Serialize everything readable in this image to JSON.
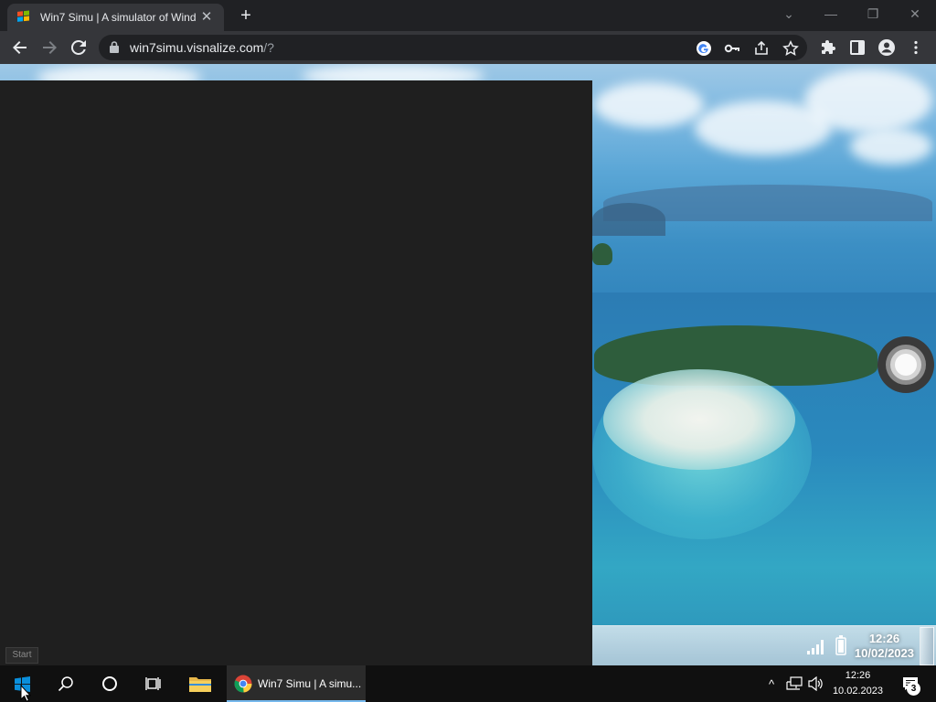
{
  "browser": {
    "tab": {
      "title": "Win7 Simu | A simulator of Wind",
      "close_glyph": "✕"
    },
    "new_tab_glyph": "+",
    "window_controls": {
      "tabsearch": "⌄",
      "minimize": "—",
      "restore": "❐",
      "close": "✕"
    },
    "address": {
      "host": "win7simu.visnalize.com",
      "path": "/?"
    }
  },
  "simulator": {
    "taskbar": {
      "time": "12:26",
      "date": "10/02/2023"
    }
  },
  "taskbar": {
    "start_tooltip": "Start",
    "chrome_label": "Win7 Simu | A simu...",
    "clock": {
      "time": "12:26",
      "date": "10.02.2023"
    },
    "notification_count": "3",
    "tray_overflow_glyph": "^"
  },
  "colors": {
    "chrome_dark": "#202124",
    "chrome_toolbar": "#35363a",
    "panel": "#1f1f1f",
    "taskbar": "#101010",
    "accent": "#76b9ed"
  }
}
